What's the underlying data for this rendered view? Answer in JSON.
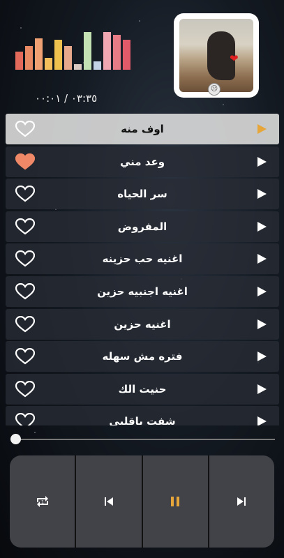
{
  "equalizer": [
    {
      "level": 0.42,
      "color": "#e36a5a"
    },
    {
      "level": 0.55,
      "color": "#e88a63"
    },
    {
      "level": 0.73,
      "color": "#f0a173"
    },
    {
      "level": 0.27,
      "color": "#f3be5c"
    },
    {
      "level": 0.69,
      "color": "#eec04e"
    },
    {
      "level": 0.55,
      "color": "#e7a98c"
    },
    {
      "level": 0.13,
      "color": "#d9c9c0"
    },
    {
      "level": 0.87,
      "color": "#c3e1b2"
    },
    {
      "level": 0.2,
      "color": "#c3d2e5"
    },
    {
      "level": 0.87,
      "color": "#f1a7b2"
    },
    {
      "level": 0.81,
      "color": "#e87c86"
    },
    {
      "level": 0.69,
      "color": "#e05a6a"
    }
  ],
  "player": {
    "time_display": "٠٣:٣٥ / ٠٠:٠١",
    "progress": 0.0
  },
  "playlist": [
    {
      "title": "اوف منه",
      "favorite": false,
      "active": true
    },
    {
      "title": "وعد مني",
      "favorite": true,
      "active": false
    },
    {
      "title": "سر الحياه",
      "favorite": false,
      "active": false
    },
    {
      "title": "المفروض",
      "favorite": false,
      "active": false
    },
    {
      "title": "اغنيه حب حزينه",
      "favorite": false,
      "active": false
    },
    {
      "title": "اغنيه اجنبيه حزين",
      "favorite": false,
      "active": false
    },
    {
      "title": "اغنيه حزين",
      "favorite": false,
      "active": false
    },
    {
      "title": "فتره مش سهله",
      "favorite": false,
      "active": false
    },
    {
      "title": "حنيت الك",
      "favorite": false,
      "active": false
    },
    {
      "title": "شفت ياقلبي",
      "favorite": false,
      "active": false
    }
  ],
  "controls": {
    "repeat_icon": "repeat-icon",
    "prev_icon": "skip-previous-icon",
    "pause_icon": "pause-icon",
    "next_icon": "skip-next-icon",
    "accent": "#e6a63a"
  }
}
